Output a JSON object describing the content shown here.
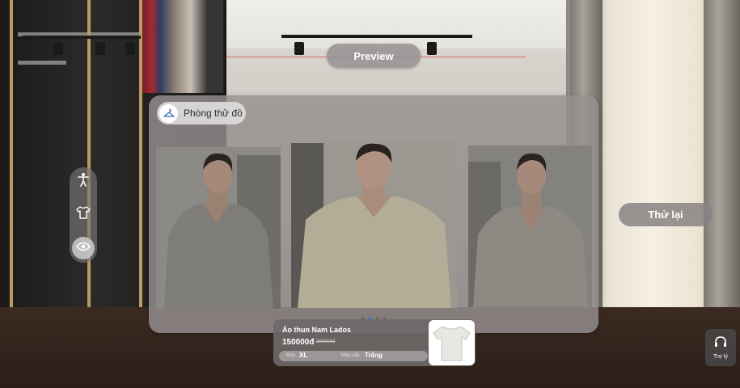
{
  "preview_label": "Preview",
  "panel": {
    "title": "Phòng thử đồ",
    "icon": "hanger-icon"
  },
  "toolbar": {
    "tools": [
      {
        "icon": "body-pose-icon"
      },
      {
        "icon": "tshirt-icon"
      },
      {
        "icon": "eye-icon",
        "active": true
      }
    ]
  },
  "carousel": {
    "images": [
      "model-left",
      "model-center",
      "model-right"
    ],
    "dots_total": 4,
    "active_dot": 2
  },
  "retry_label": "Thử lại",
  "product": {
    "name": "Áo thun Nam Lados",
    "price": "150000đ",
    "old_price": "200000đ",
    "size_label": "Size",
    "size_value": "XL",
    "color_label": "Màu sắc",
    "color_value": "Trắng"
  },
  "support_label": "Trợ lý",
  "colors": {
    "active_dot": "#3a7bd5",
    "panel": "#969090"
  }
}
